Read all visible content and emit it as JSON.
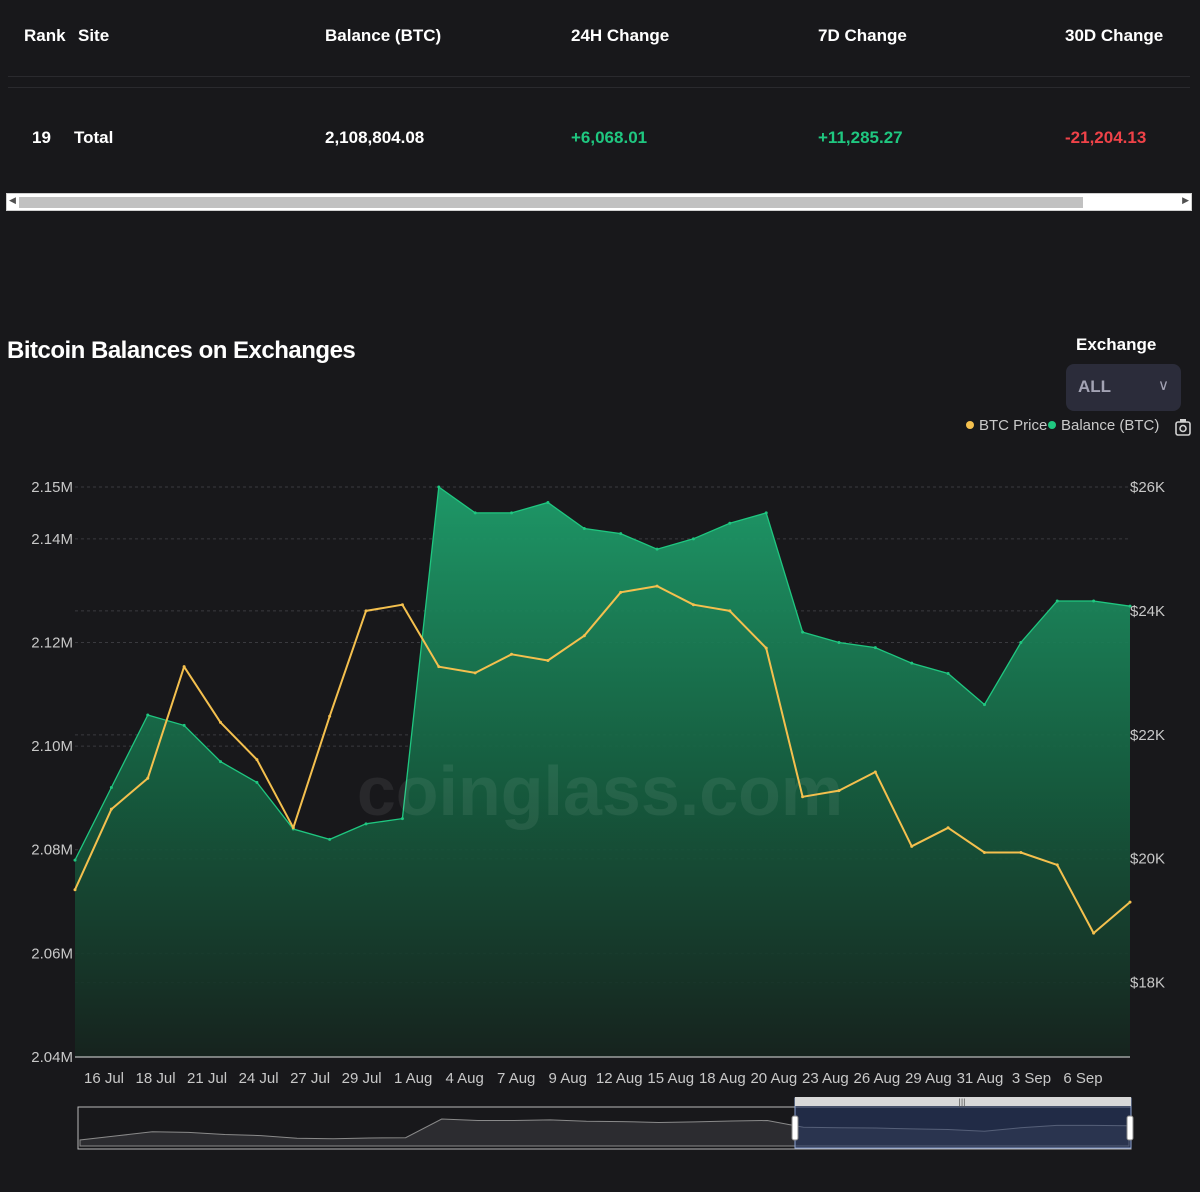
{
  "table": {
    "headers": [
      "Rank",
      "Site",
      "Balance (BTC)",
      "24H Change",
      "7D Change",
      "30D Change"
    ],
    "row": {
      "rank": "19",
      "site": "Total",
      "balance": "2,108,804.08",
      "change_24h": "+6,068.01",
      "change_7d": "+11,285.27",
      "change_30d": "-21,204.13"
    }
  },
  "colors": {
    "positive": "#1fc780",
    "negative": "#ef4248",
    "btc_price": "#f4c04e",
    "balance": "#1fc780"
  },
  "chart_section": {
    "title": "Bitcoin Balances on Exchanges",
    "exchange_label": "Exchange",
    "exchange_value": "ALL",
    "watermark": "coinglass.com"
  },
  "chart_data": {
    "type": "area",
    "title": "Bitcoin Balances on Exchanges",
    "legend": [
      "BTC Price",
      "Balance (BTC)"
    ],
    "legend_position": "top-right",
    "grid": true,
    "x": [
      "16 Jul",
      "18 Jul",
      "21 Jul",
      "24 Jul",
      "27 Jul",
      "29 Jul",
      "1 Aug",
      "4 Aug",
      "7 Aug",
      "9 Aug",
      "12 Aug",
      "15 Aug",
      "18 Aug",
      "20 Aug",
      "23 Aug",
      "26 Aug",
      "29 Aug",
      "31 Aug",
      "3 Sep",
      "6 Sep"
    ],
    "x_tick_labels": [
      "16 Jul",
      "18 Jul",
      "21 Jul",
      "24 Jul",
      "27 Jul",
      "29 Jul",
      "1 Aug",
      "4 Aug",
      "7 Aug",
      "9 Aug",
      "12 Aug",
      "15 Aug",
      "18 Aug",
      "20 Aug",
      "23 Aug",
      "26 Aug",
      "29 Aug",
      "31 Aug",
      "3 Sep",
      "6 Sep"
    ],
    "y_left": {
      "label": "",
      "ticks": [
        "2.04M",
        "2.06M",
        "2.08M",
        "2.10M",
        "2.12M",
        "2.14M",
        "2.15M"
      ],
      "range": [
        2040000,
        2150000
      ]
    },
    "y_right": {
      "label": "",
      "ticks": [
        "$18K",
        "$20K",
        "$22K",
        "$24K",
        "$26K"
      ],
      "range": [
        16800,
        26000
      ]
    },
    "series": [
      {
        "name": "Balance (BTC)",
        "axis": "left",
        "values": [
          2078000,
          2092000,
          2106000,
          2104000,
          2097000,
          2093000,
          2084000,
          2082000,
          2085000,
          2086000,
          2150000,
          2145000,
          2145000,
          2147000,
          2142000,
          2141000,
          2138000,
          2140000,
          2143000,
          2145000,
          2122000,
          2120000,
          2119000,
          2116000,
          2114000,
          2108000,
          2120000,
          2128000,
          2128000,
          2127000
        ]
      },
      {
        "name": "BTC Price",
        "axis": "right",
        "values": [
          19500,
          20800,
          21300,
          23100,
          22200,
          21600,
          20500,
          22300,
          24000,
          24100,
          23100,
          23000,
          23300,
          23200,
          23600,
          24300,
          24400,
          24100,
          24000,
          23400,
          21000,
          21100,
          21400,
          20200,
          20500,
          20100,
          20100,
          19900,
          18800,
          19300
        ]
      }
    ]
  }
}
